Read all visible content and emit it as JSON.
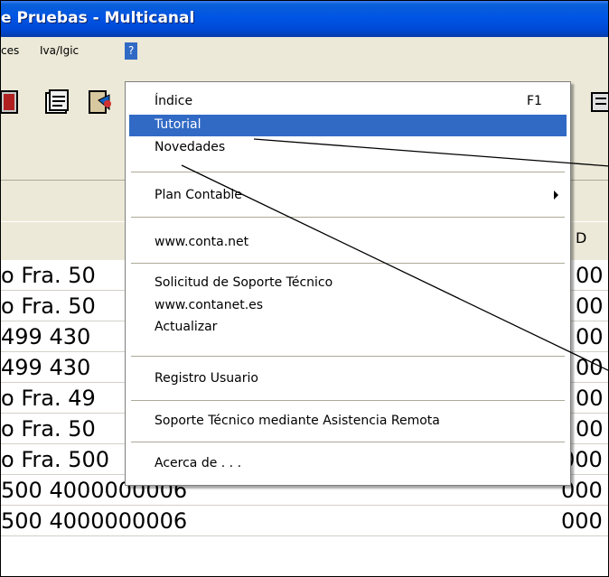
{
  "window": {
    "title": "e Pruebas - Multicanal"
  },
  "menubar": {
    "items": [
      {
        "label": "ces"
      },
      {
        "label": "Iva/Igic"
      },
      {
        "label": "?"
      }
    ]
  },
  "grid": {
    "header_right": "D",
    "rows": [
      {
        "desc": "o Fra. 50",
        "code": "00"
      },
      {
        "desc": "o Fra. 50",
        "code": "00"
      },
      {
        "desc": " 499 430",
        "code": "00"
      },
      {
        "desc": " 499 430",
        "code": "00"
      },
      {
        "desc": "o Fra. 49",
        "code": "00"
      },
      {
        "desc": "o Fra. 50",
        "code": "00"
      },
      {
        "desc": "o Fra. 500",
        "code": "000"
      },
      {
        "desc": " 500 4000000006",
        "code": "000"
      },
      {
        "desc": " 500 4000000006",
        "code": "000"
      }
    ]
  },
  "help_menu": {
    "items": [
      {
        "label": "Índice",
        "shortcut": "F1"
      },
      {
        "label": "Tutorial"
      },
      {
        "label": "Novedades"
      },
      {
        "label": "Plan Contable"
      },
      {
        "label": "www.conta.net"
      },
      {
        "label": "Solicitud de Soporte Técnico"
      },
      {
        "label": "www.contanet.es"
      },
      {
        "label": "Actualizar"
      },
      {
        "label": "Registro Usuario"
      },
      {
        "label": "Soporte Técnico mediante Asistencia Remota"
      },
      {
        "label": "Acerca de . . ."
      }
    ]
  },
  "colors": {
    "highlight": "#316ac5",
    "titlebar": "#0055e5",
    "face": "#ece9d8"
  }
}
